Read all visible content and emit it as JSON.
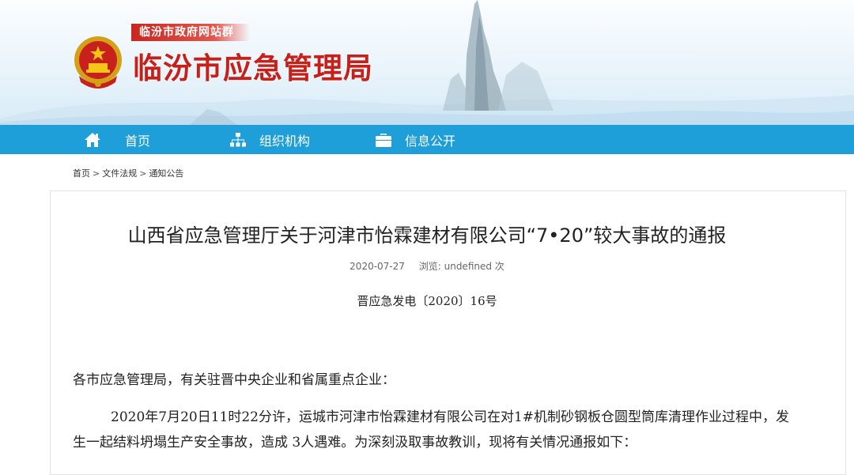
{
  "header": {
    "site_group": "临汾市政府网站群",
    "site_title": "临汾市应急管理局",
    "emblem_icon": "national-emblem-icon"
  },
  "nav": {
    "items": [
      {
        "label": "首页",
        "icon": "home-icon"
      },
      {
        "label": "组织机构",
        "icon": "org-chart-icon"
      },
      {
        "label": "信息公开",
        "icon": "briefcase-icon"
      }
    ],
    "color": "#1e9fd9"
  },
  "breadcrumb": {
    "items": [
      "首页",
      "文件法规",
      "通知公告"
    ],
    "separator": ">"
  },
  "article": {
    "title": "山西省应急管理厅关于河津市怡霖建材有限公司“7•20”较大事故的通报",
    "date": "2020-07-27",
    "views": "浏览: undefined 次",
    "doc_number": "晋应急发电〔2020〕16号",
    "paragraphs": [
      "各市应急管理局，有关驻晋中央企业和省属重点企业：",
      "2020年7月20日11时22分许，运城市河津市怡霖建材有限公司在对1#机制砂钢板仓圆型筒库清理作业过程中，发生一起结料坍塌生产安全事故，造成 3人遇难。为深刻汲取事故教训，现将有关情况通报如下："
    ]
  },
  "colors": {
    "title_red": "#c5201a",
    "nav_blue": "#1e9fd9"
  }
}
